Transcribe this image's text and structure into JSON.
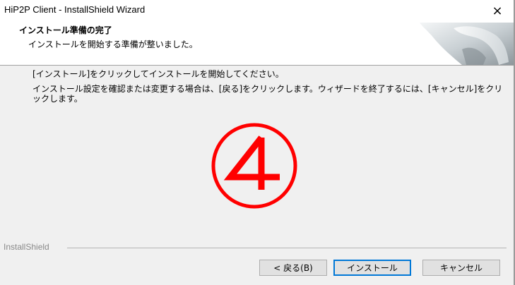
{
  "window": {
    "title": "HiP2P Client - InstallShield Wizard",
    "close_glyph": "×"
  },
  "header": {
    "title": "インストール準備の完了",
    "subtitle": "インストールを開始する準備が整いました。",
    "graphic_icon": "installshield-curl-graphic"
  },
  "content": {
    "instruction": "[インストール]をクリックしてインストールを開始してください。",
    "details": "インストール設定を確認または変更する場合は、[戻る]をクリックします。ウィザードを終了するには、[キャンセル]をクリックします。",
    "step_marker": "④",
    "marker_color": "#ff0000"
  },
  "footer": {
    "brand": "InstallShield"
  },
  "buttons": {
    "back": "< 戻る(B)",
    "install": "インストール",
    "cancel": "キャンセル"
  },
  "colors": {
    "accent": "#0078d7",
    "dialog_bg": "#f0f0f0"
  }
}
